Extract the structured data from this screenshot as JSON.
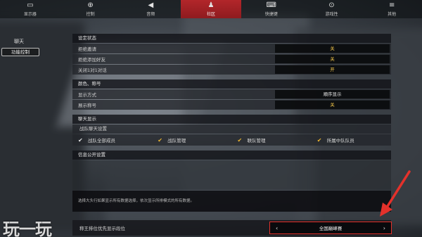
{
  "nav": {
    "items": [
      {
        "label": "显示器",
        "icon": "monitor-icon",
        "glyph": "▭"
      },
      {
        "label": "控制",
        "icon": "gamepad-icon",
        "glyph": "⊕"
      },
      {
        "label": "音频",
        "icon": "speaker-icon",
        "glyph": "◀"
      },
      {
        "label": "社区",
        "icon": "person-icon",
        "glyph": "♟"
      },
      {
        "label": "快捷键",
        "icon": "keyboard-icon",
        "glyph": "⌨"
      },
      {
        "label": "游戏性",
        "icon": "crosshair-icon",
        "glyph": "⊙"
      },
      {
        "label": "其他",
        "icon": "menu-icon",
        "glyph": "≡"
      }
    ],
    "active_index": 3
  },
  "sidebar": {
    "title": "聊天",
    "button": "功能控制"
  },
  "sections": {
    "status": {
      "header": "设定状态",
      "rows": [
        {
          "label": "拒绝邀请",
          "value": "关"
        },
        {
          "label": "拒绝添加好友",
          "value": "关"
        },
        {
          "label": "关闭1对1对话",
          "value": "开"
        }
      ]
    },
    "title": {
      "header": "颜色、称号",
      "rows": [
        {
          "label": "显示方式",
          "value": "顺序显示"
        },
        {
          "label": "展示称号",
          "value": "关"
        }
      ]
    },
    "chat": {
      "header": "聊天显示",
      "sub": "战队聊天设置",
      "checks": [
        {
          "label": "战队全部成员",
          "mark": "✔"
        },
        {
          "label": "战队管理",
          "mark": "✔"
        },
        {
          "label": "联队管理",
          "mark": "✔"
        },
        {
          "label": "所属中队队员",
          "mark": "✔"
        }
      ]
    },
    "info": {
      "header": "信息公开设置",
      "description": "选择大头行如果显示所有数据选择，依次显示所排模式的所有数据。"
    },
    "bottom": {
      "label": "称王排位优先显示段位",
      "value": "全国巅峰赛",
      "left_arrow": "‹",
      "right_arrow": "›"
    }
  },
  "watermark": "玩一玩",
  "colors": {
    "accent_red": "#b2262a",
    "value_gold": "#f3c64a",
    "highlight_border": "#e4312b"
  }
}
